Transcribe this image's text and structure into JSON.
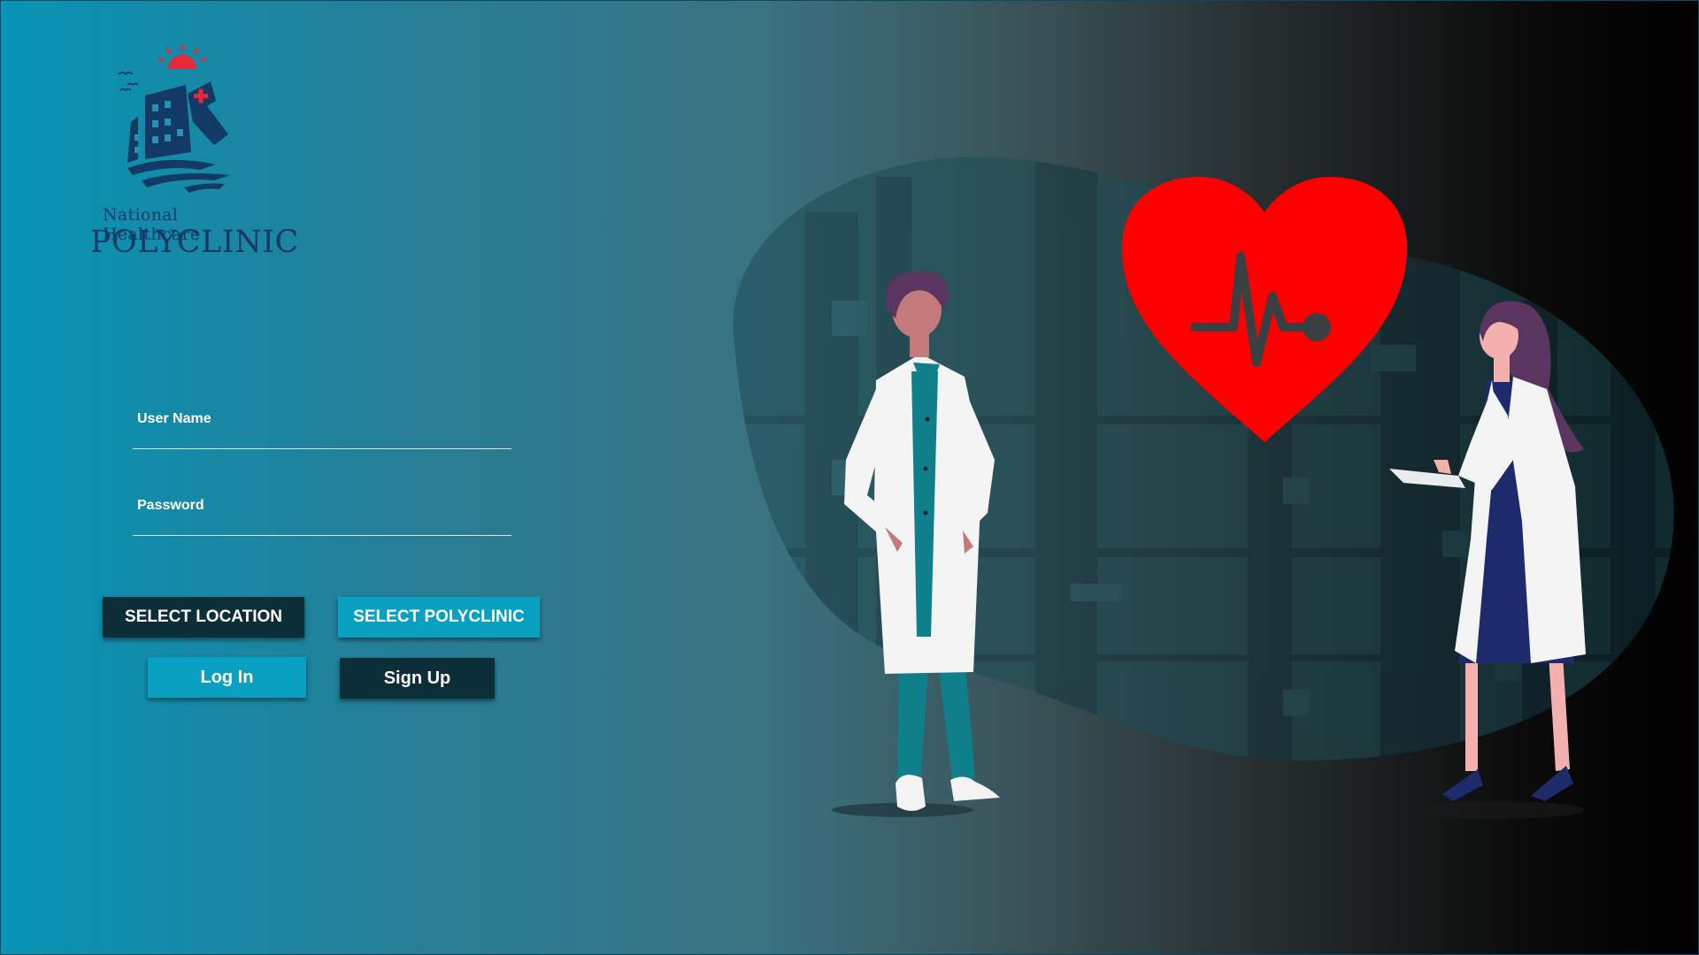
{
  "brand": {
    "subtitle": "National Healthcare",
    "title": "POLYCLINIC"
  },
  "form": {
    "username_label": "User Name",
    "username_value": "",
    "password_label": "Password",
    "password_value": ""
  },
  "buttons": {
    "select_location": "SELECT LOCATION",
    "select_polyclinic": "SELECT POLYCLINIC",
    "login": "Log In",
    "signup": "Sign Up"
  },
  "colors": {
    "gradient_start": "#0794b6",
    "gradient_end": "#000000",
    "dark_button": "#0c2e38",
    "light_button": "#0aa0c2",
    "heart": "#ff0000",
    "logo": "#123a64"
  }
}
